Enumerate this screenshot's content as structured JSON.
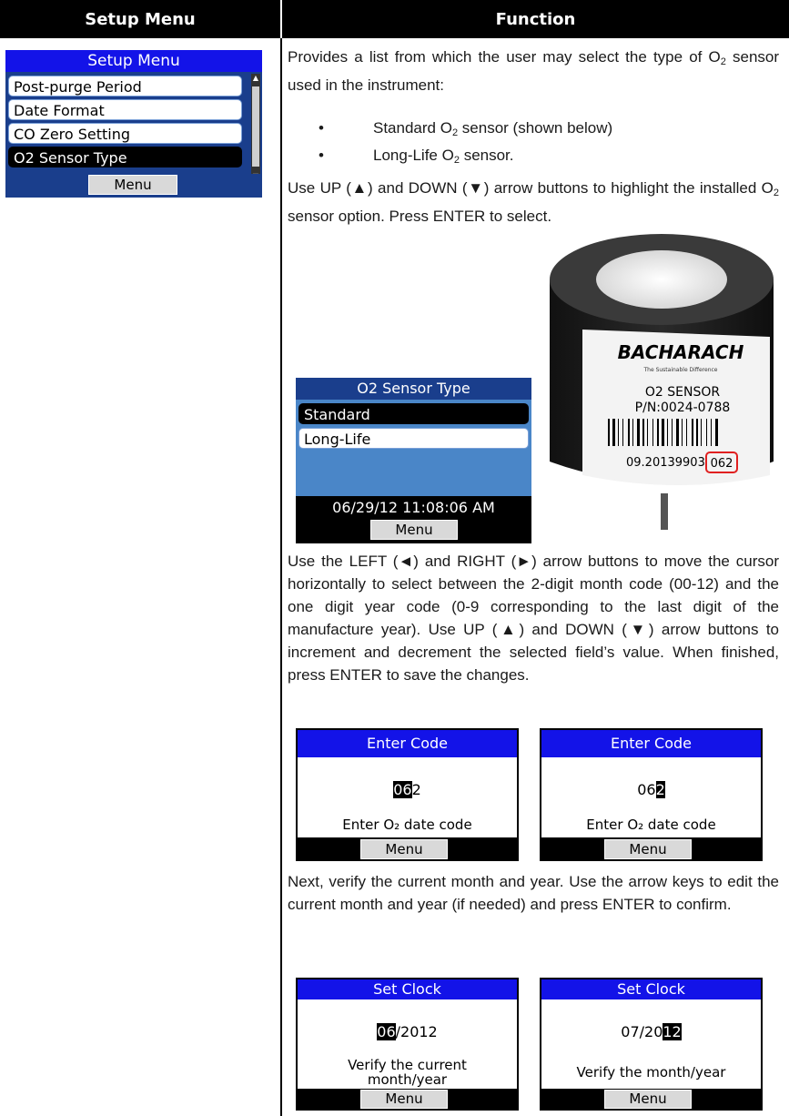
{
  "table": {
    "col_left": "Setup Menu",
    "col_right": "Function"
  },
  "setup_screen": {
    "title": "Setup Menu",
    "options": [
      "Post-purge Period",
      "Date Format",
      "CO Zero Setting",
      "O2 Sensor Type"
    ],
    "selected": "O2 Sensor Type",
    "menu": "Menu"
  },
  "text": {
    "p1a": "Provides a list from which the user may select the type of O",
    "p1b": " sensor used in the instrument:",
    "b1a": "Standard O",
    "b1b": " sensor (shown below)",
    "b2a": "Long-Life O",
    "b2b": " sensor.",
    "p2a": "Use UP (▲) and DOWN (▼) arrow buttons to highlight the installed O",
    "p2b": " sensor option.  Press ENTER to select.",
    "p3": "Use the LEFT (◄) and RIGHT (►) arrow buttons to move the cursor horizontally to select between the 2-digit month code (00-12) and the one digit year code (0-9 corresponding to the last digit of the manufacture year).  Use UP (▲) and DOWN (▼) arrow buttons to increment and decrement the selected field’s value.  When finished, press ENTER to save the changes.",
    "p4": "Next, verify the current month and year.  Use the arrow keys to edit the current month and year (if needed) and press ENTER to confirm.",
    "sub2": "2"
  },
  "o2_screen": {
    "title": "O2 Sensor Type",
    "options": [
      "Standard",
      "Long-Life"
    ],
    "datetime": "06/29/12 11:08:06 AM",
    "menu": "Menu"
  },
  "sensor_photo": {
    "brand": "BACHARACH",
    "tagline": "The Sustainable Difference",
    "label1": "O2 SENSOR",
    "label2": "P/N:0024-0788",
    "serial": "09.20139903",
    "code": "062"
  },
  "code_screens": [
    {
      "title": "Enter Code",
      "hl": "06",
      "rest": "2",
      "pre": "",
      "prompt": "Enter O₂ date code",
      "menu": "Menu"
    },
    {
      "title": "Enter Code",
      "pre": "06",
      "hl": "2",
      "rest": "",
      "prompt": "Enter O₂ date code",
      "menu": "Menu"
    }
  ],
  "clock_screens": [
    {
      "title": "Set Clock",
      "hl": "06",
      "rest": "/2012",
      "pre": "",
      "prompt1": "Verify the current",
      "prompt2": "month/year",
      "menu": "Menu"
    },
    {
      "title": "Set Clock",
      "pre": "07/20",
      "hl": "12",
      "rest": "",
      "prompt1": "Verify the month/year",
      "prompt2": "",
      "menu": "Menu"
    }
  ],
  "colors": {
    "title_blue": "#1313e8",
    "screen_blue": "#4a86c8",
    "dark_navy": "#1a3e8c",
    "highlight_red": "#e02020"
  }
}
